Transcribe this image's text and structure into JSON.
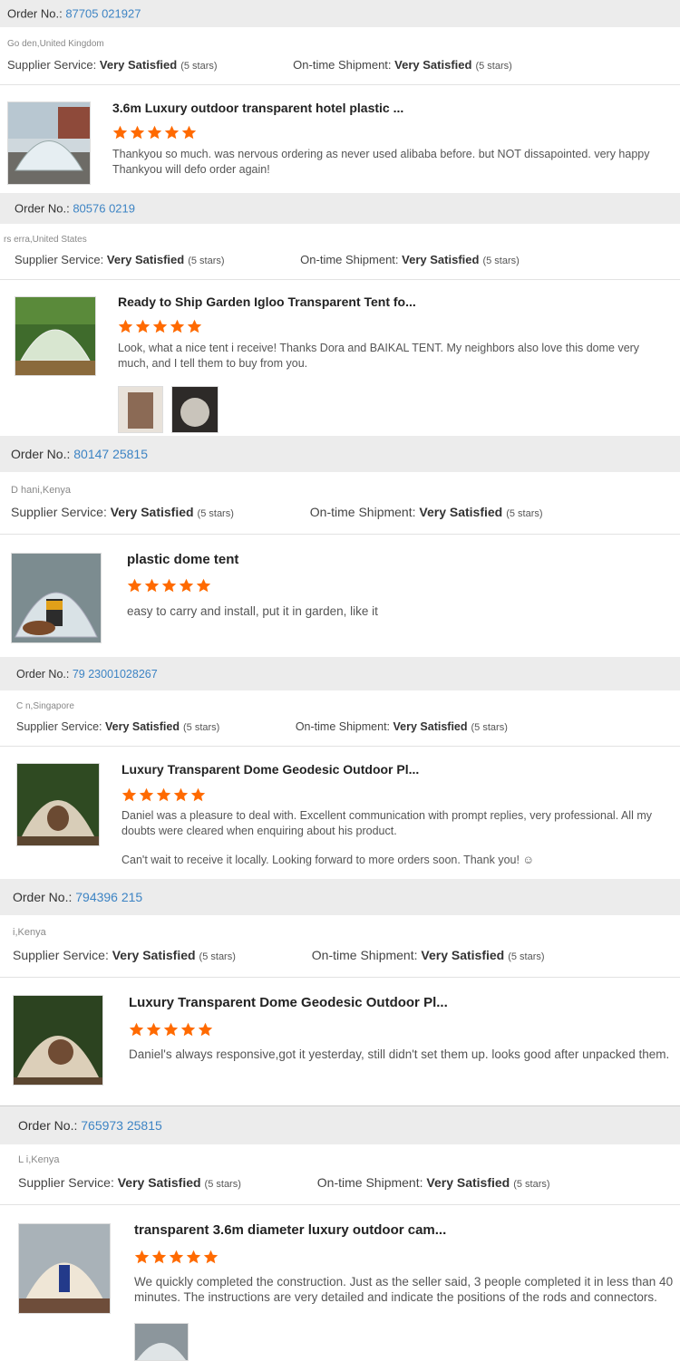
{
  "labels": {
    "order_prefix": "Order No.:",
    "supplier_service": "Supplier Service:",
    "ontime_shipment": "On-time Shipment:",
    "very_satisfied": "Very Satisfied",
    "five_stars": "(5 stars)"
  },
  "colors": {
    "star": "#ff6a00",
    "order_number": "#3d84c4",
    "order_bar": "#ececec"
  },
  "reviews": [
    {
      "order_no": "87705 021927",
      "location": "Go den,United Kingdom",
      "product_title": "3.6m Luxury outdoor transparent hotel plastic ...",
      "rating": 5,
      "text": "Thankyou so much. was nervous ordering as never used alibaba before. but NOT dissapointed. very happy Thankyou will defo order again!"
    },
    {
      "order_no": "80576 0219",
      "location": "rs erra,United States",
      "product_title": "Ready to Ship Garden Igloo Transparent Tent fo...",
      "rating": 5,
      "text": "Look, what a nice tent i receive! Thanks Dora and BAIKAL TENT. My neighbors also love this dome very much, and I tell them to buy from you."
    },
    {
      "order_no": "80147 25815",
      "location": "D hani,Kenya",
      "product_title": "plastic dome tent",
      "rating": 5,
      "text": "easy to carry and install, put it in garden, like it"
    },
    {
      "order_no": "79 23001028267",
      "location": "C n,Singapore",
      "product_title": "Luxury Transparent Dome Geodesic Outdoor Pl...",
      "rating": 5,
      "text": "Daniel was a pleasure to deal with. Excellent communication with prompt replies, very professional. All my doubts were cleared when enquiring about his product.",
      "text2": "Can't wait to receive it locally. Looking forward to more orders soon. Thank you! ☺"
    },
    {
      "order_no": "794396 215",
      "location": "i,Kenya",
      "product_title": "Luxury Transparent Dome Geodesic Outdoor Pl...",
      "rating": 5,
      "text": "Daniel's always responsive,got it yesterday, still didn't set them up. looks good after unpacked them."
    },
    {
      "order_no": "765973 25815",
      "location": "L i,Kenya",
      "product_title": "transparent 3.6m diameter luxury outdoor cam...",
      "rating": 5,
      "text": "We quickly completed the construction. Just as the seller said, 3 people completed it in less than 40 minutes. The instructions are very detailed and indicate the positions of the rods and connectors."
    }
  ]
}
